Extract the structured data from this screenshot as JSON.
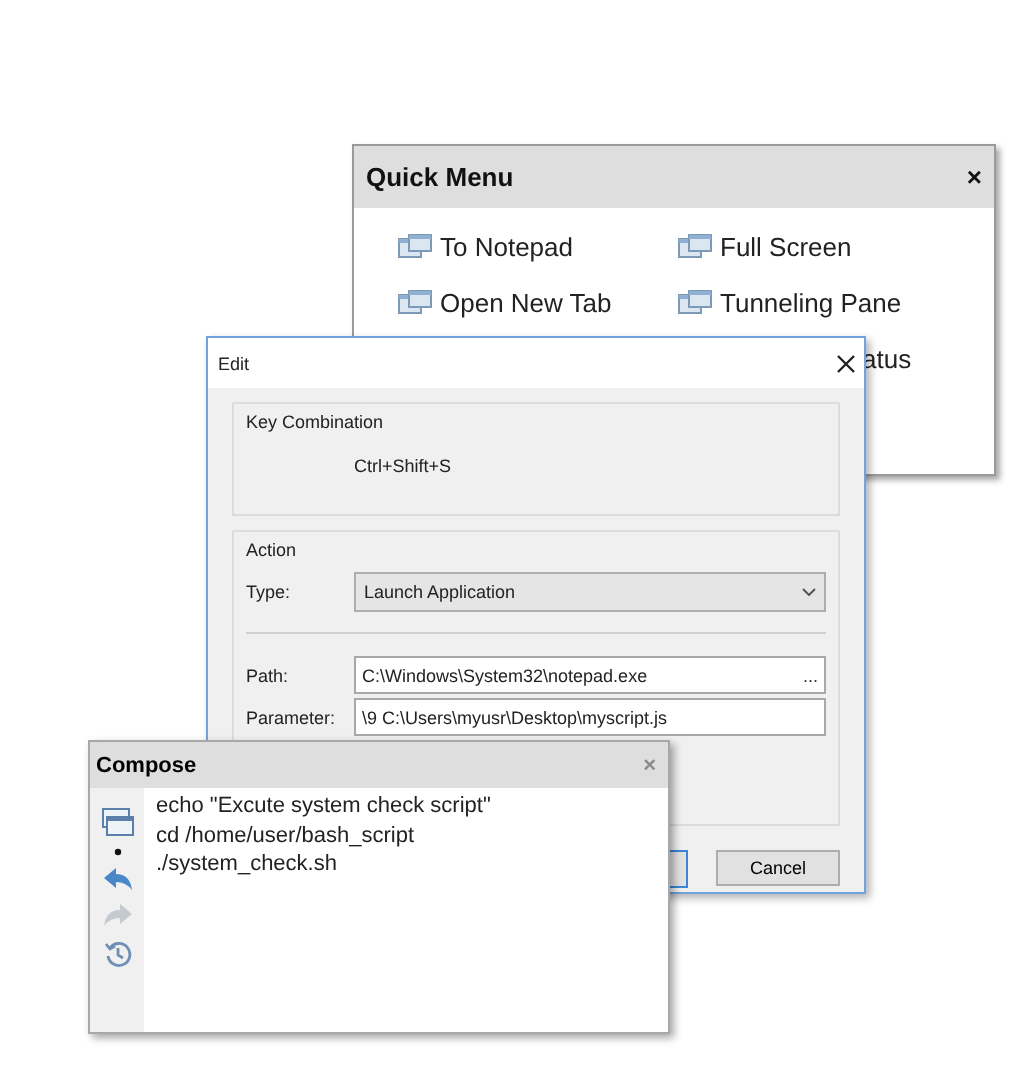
{
  "quick_menu": {
    "title": "Quick Menu",
    "close": "×",
    "items": [
      {
        "label": "To Notepad",
        "partial": false
      },
      {
        "label": "Full Screen",
        "partial": false
      },
      {
        "label": "Open New Tab",
        "partial": false
      },
      {
        "label": "Tunneling Pane",
        "partial": false
      },
      {
        "label": "atus",
        "partial": true
      }
    ]
  },
  "edit_dialog": {
    "title": "Edit",
    "key_group": "Key Combination",
    "key_value": "Ctrl+Shift+S",
    "action_group": "Action",
    "type_label": "Type:",
    "type_value": "Launch Application",
    "path_label": "Path:",
    "path_value": "C:\\Windows\\System32\\notepad.exe",
    "browse": "...",
    "parameter_label": "Parameter:",
    "parameter_value": "\\9 C:\\Users\\myusr\\Desktop\\myscript.js",
    "cancel": "Cancel"
  },
  "compose": {
    "title": "Compose",
    "close": "×",
    "tools": [
      {
        "kind": "windows",
        "disabled": false
      },
      {
        "kind": "dot",
        "disabled": false
      },
      {
        "kind": "undo",
        "disabled": false
      },
      {
        "kind": "redo",
        "disabled": true
      },
      {
        "kind": "history",
        "disabled": false
      }
    ],
    "lines": [
      "echo \"Excute system check script\"",
      "cd /home/user/bash_script",
      "./system_check.sh"
    ]
  }
}
